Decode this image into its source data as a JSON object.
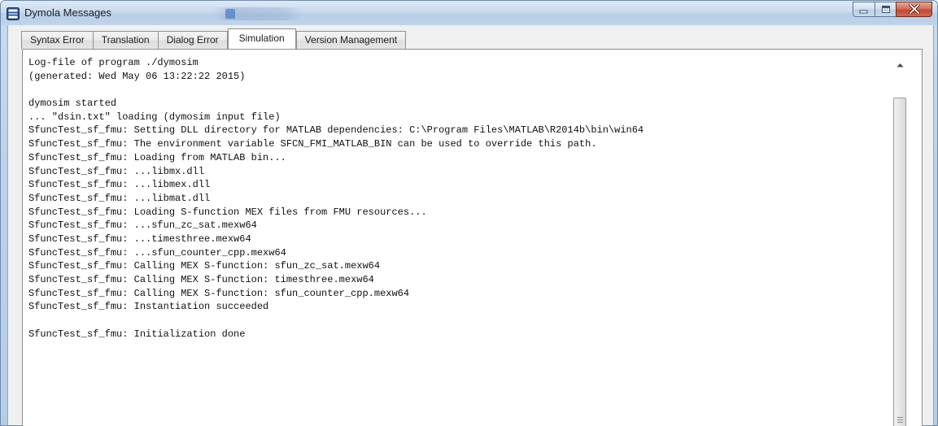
{
  "window": {
    "title": "Dymola Messages"
  },
  "tabs": [
    {
      "label": "Syntax Error",
      "active": false
    },
    {
      "label": "Translation",
      "active": false
    },
    {
      "label": "Dialog Error",
      "active": false
    },
    {
      "label": "Simulation",
      "active": true
    },
    {
      "label": "Version Management",
      "active": false
    }
  ],
  "log": {
    "lines": [
      "Log-file of program ./dymosim",
      "(generated: Wed May 06 13:22:22 2015)",
      "",
      "dymosim started",
      "... \"dsin.txt\" loading (dymosim input file)",
      "SfuncTest_sf_fmu: Setting DLL directory for MATLAB dependencies: C:\\Program Files\\MATLAB\\R2014b\\bin\\win64",
      "SfuncTest_sf_fmu: The environment variable SFCN_FMI_MATLAB_BIN can be used to override this path.",
      "SfuncTest_sf_fmu: Loading from MATLAB bin...",
      "SfuncTest_sf_fmu: ...libmx.dll",
      "SfuncTest_sf_fmu: ...libmex.dll",
      "SfuncTest_sf_fmu: ...libmat.dll",
      "SfuncTest_sf_fmu: Loading S-function MEX files from FMU resources...",
      "SfuncTest_sf_fmu: ...sfun_zc_sat.mexw64",
      "SfuncTest_sf_fmu: ...timesthree.mexw64",
      "SfuncTest_sf_fmu: ...sfun_counter_cpp.mexw64",
      "SfuncTest_sf_fmu: Calling MEX S-function: sfun_zc_sat.mexw64",
      "SfuncTest_sf_fmu: Calling MEX S-function: timesthree.mexw64",
      "SfuncTest_sf_fmu: Calling MEX S-function: sfun_counter_cpp.mexw64",
      "SfuncTest_sf_fmu: Instantiation succeeded",
      "",
      "SfuncTest_sf_fmu: Initialization done"
    ]
  },
  "icons": {
    "app": "dymola-app-icon",
    "minimize": "minimize-icon",
    "maximize": "maximize-icon",
    "close": "close-icon",
    "scroll_up": "chevron-up-icon",
    "grip": "scrollbar-grip-icon"
  },
  "colors": {
    "close_button": "#c04a32",
    "title_bar": "#bfd4eb",
    "active_tab": "#ffffff"
  }
}
